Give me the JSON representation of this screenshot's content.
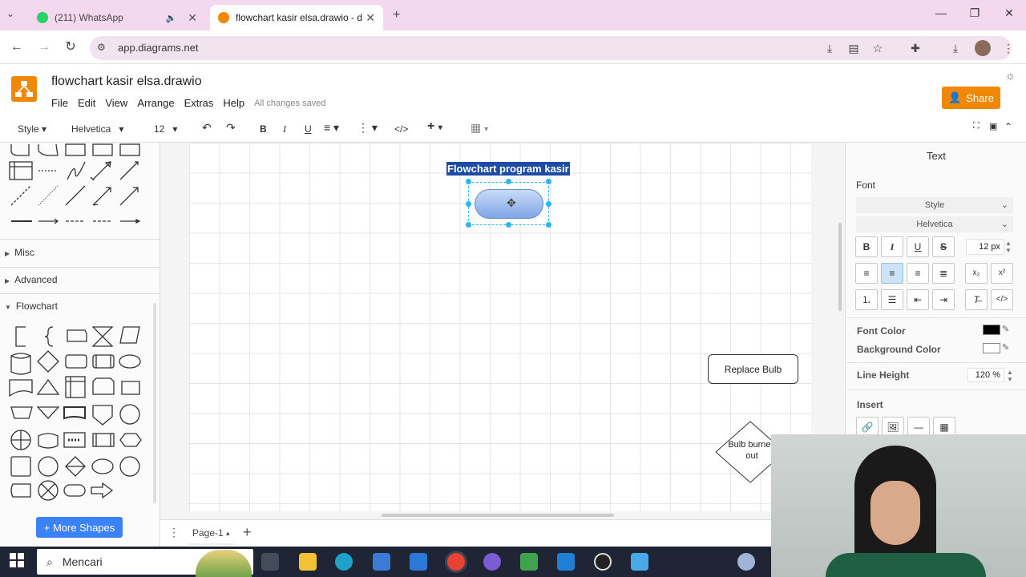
{
  "browser": {
    "tabs": [
      {
        "label": "(211) WhatsApp",
        "icon": "whatsapp-icon"
      },
      {
        "label": "flowchart kasir elsa.drawio - dra",
        "icon": "drawio-icon"
      }
    ],
    "url": "app.diagrams.net"
  },
  "app": {
    "title": "flowchart kasir elsa.drawio",
    "menu": [
      "File",
      "Edit",
      "View",
      "Arrange",
      "Extras",
      "Help"
    ],
    "saved_status": "All changes saved",
    "share_label": "Share"
  },
  "toolbar": {
    "style_label": "Style",
    "font_name": "Helvetica",
    "font_size": "12",
    "bold": "B",
    "italic": "I",
    "underline": "U",
    "code": "</>"
  },
  "sidebar": {
    "sections": [
      {
        "label": "Misc"
      },
      {
        "label": "Advanced"
      },
      {
        "label": "Flowchart"
      }
    ],
    "more_shapes_label": "+ More Shapes"
  },
  "canvas": {
    "title_text": "Flowchart program kasir",
    "replace_bulb_label": "Replace Bulb",
    "bulb_label": "Bulb burned out"
  },
  "pagebar": {
    "page_label": "Page-1"
  },
  "format_panel": {
    "tab_label": "Text",
    "font_heading": "Font",
    "style_select": "Style",
    "font_select": "Helvetica",
    "font_size": "12 px",
    "bold": "B",
    "italic": "I",
    "underline": "U",
    "strike": "S",
    "subscript": "x₂",
    "superscript": "x²",
    "code": "</>",
    "font_color_label": "Font Color",
    "font_color": "#000000",
    "background_color_label": "Background Color",
    "background_color": "#ffffff",
    "line_height_label": "Line Height",
    "line_height": "120 %",
    "insert_label": "Insert"
  },
  "taskbar": {
    "search_label": "Mencari"
  },
  "colors": {
    "accent": "#f08705",
    "selection_handle": "#29b6f2",
    "title_highlight": "#1e4ba6",
    "more_shapes": "#3b82f6"
  }
}
